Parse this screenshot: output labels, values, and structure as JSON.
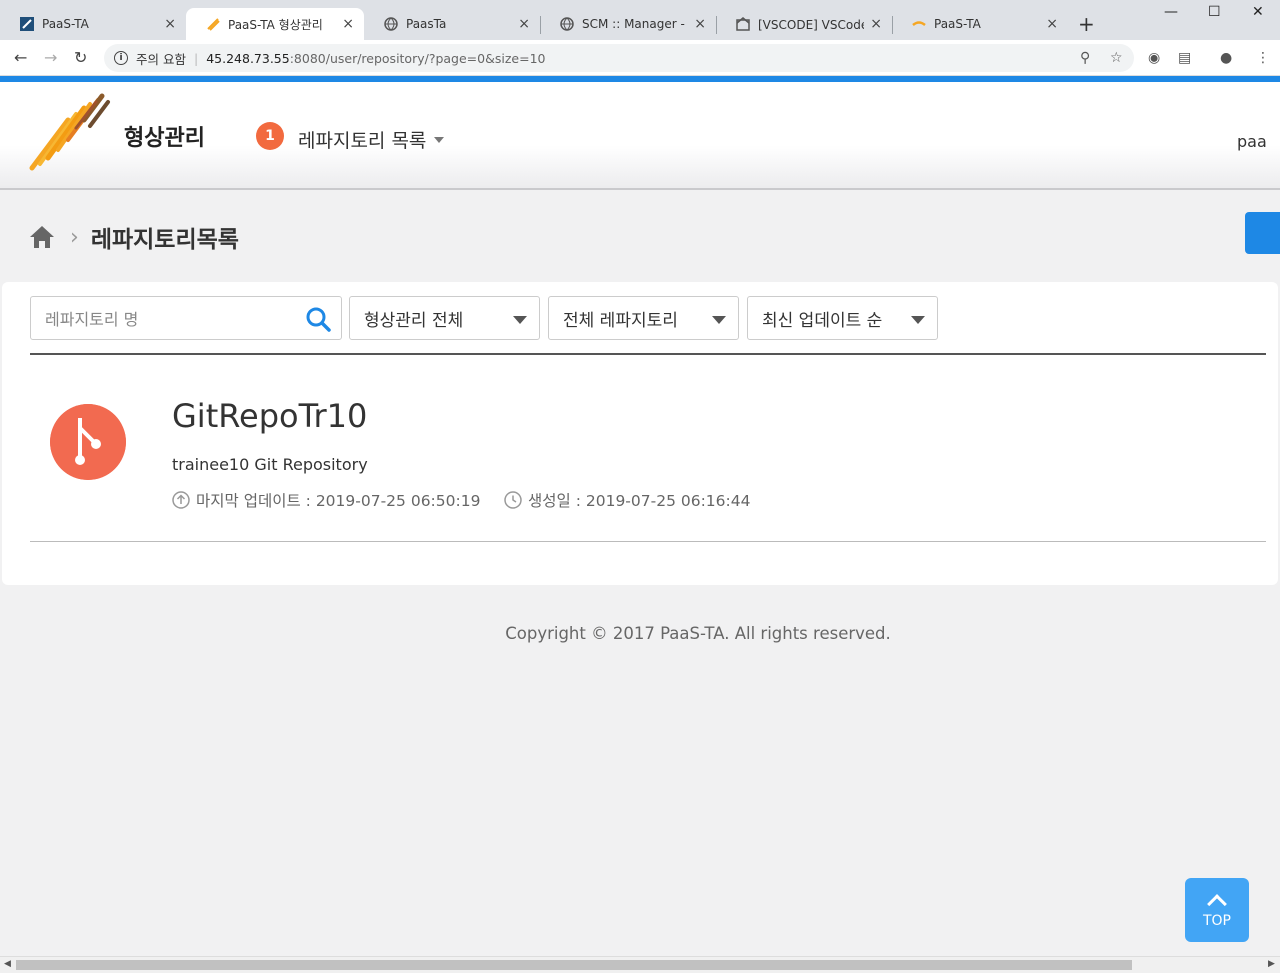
{
  "browser": {
    "tabs": [
      {
        "title": "PaaS-TA",
        "close": "×"
      },
      {
        "title": "PaaS-TA 형상관리",
        "close": "×"
      },
      {
        "title": "PaasTa",
        "close": "×"
      },
      {
        "title": "SCM :: Manager - Git",
        "close": "×"
      },
      {
        "title": "[VSCODE] VSCode에 G",
        "close": "×"
      },
      {
        "title": "PaaS-TA",
        "close": "×"
      }
    ],
    "new_tab": "+",
    "security_label": "주의 요함",
    "url_host": "45.248.73.55",
    "url_rest": ":8080/user/repository/?page=0&size=10"
  },
  "header": {
    "brand": "형상관리",
    "badge_count": "1",
    "menu_label": "레파지토리 목록",
    "user": "paa"
  },
  "breadcrumb": {
    "title": "레파지토리목록"
  },
  "filters": {
    "search_placeholder": "레파지토리 명",
    "scm_type": "형상관리 전체",
    "repo_scope": "전체 레파지토리",
    "sort": "최신 업데이트 순"
  },
  "repositories": [
    {
      "name": "GitRepoTr10",
      "description": "trainee10 Git Repository",
      "updated_label": "마지막 업데이트 : 2019-07-25 06:50:19",
      "created_label": "생성일 : 2019-07-25 06:16:44"
    }
  ],
  "footer": {
    "copyright": "Copyright © 2017 PaaS-TA. All rights reserved."
  },
  "top_button": "TOP",
  "colors": {
    "accent": "#1e88e5",
    "badge": "#f26a3f",
    "repo_icon": "#f26a50"
  }
}
